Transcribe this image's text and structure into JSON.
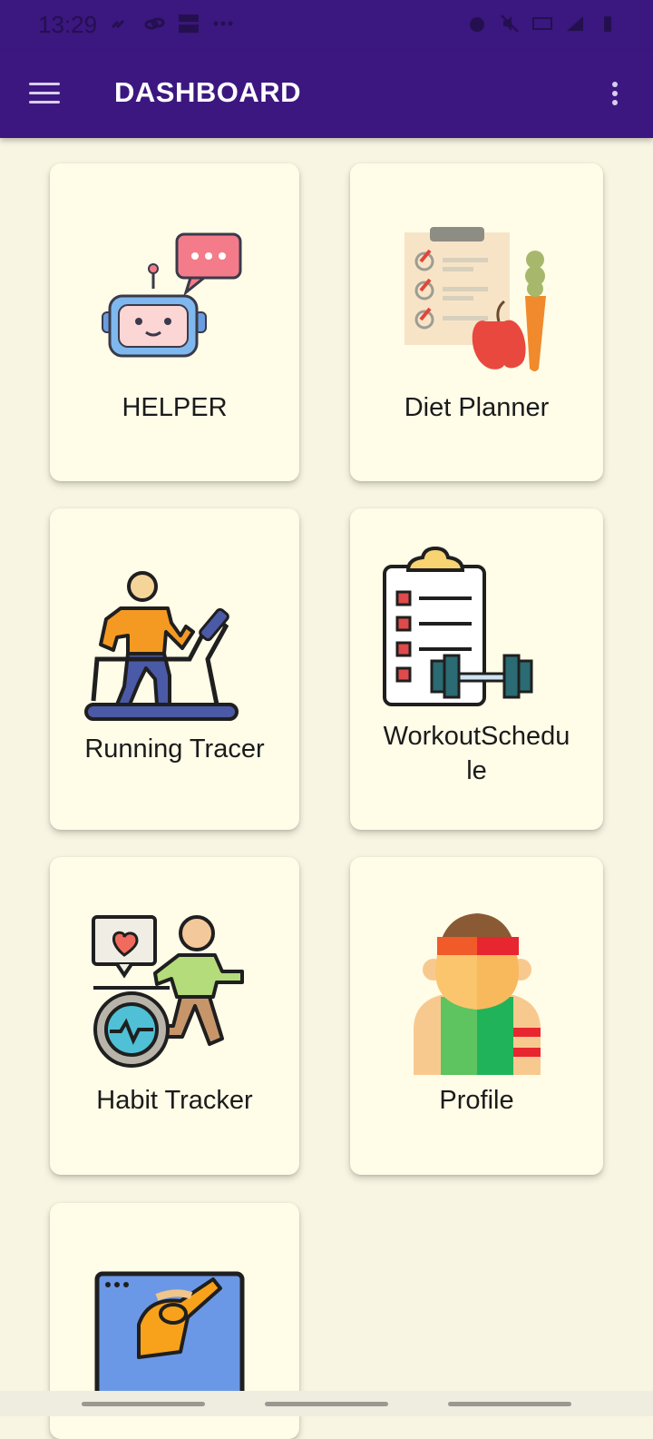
{
  "status_bar": {
    "time": "13:29",
    "left_icons": [
      "link-icon",
      "link-icon",
      "media-icon",
      "more-icon"
    ],
    "right_icons": [
      "alarm-icon",
      "mute-icon",
      "volte-icon",
      "signal-icon",
      "battery-icon"
    ]
  },
  "app_bar": {
    "title": "DASHBOARD",
    "menu_icon": "hamburger-icon",
    "overflow_icon": "more-vert-icon",
    "color": "#3d1780"
  },
  "dashboard": {
    "cards": [
      {
        "label": "HELPER",
        "icon": "robot-chat-icon"
      },
      {
        "label": "Diet Planner",
        "icon": "diet-plan-icon"
      },
      {
        "label": "Running Tracer",
        "icon": "treadmill-runner-icon"
      },
      {
        "label": "WorkoutSchedu\nle",
        "icon": "workout-clipboard-icon"
      },
      {
        "label": "Habit Tracker",
        "icon": "habit-runner-icon"
      },
      {
        "label": "Profile",
        "icon": "athlete-profile-icon"
      },
      {
        "label": "",
        "icon": "stretching-screen-icon"
      }
    ]
  },
  "colors": {
    "background": "#f8f5e2",
    "card": "#fffce8",
    "status_bar": "#3b1780"
  }
}
